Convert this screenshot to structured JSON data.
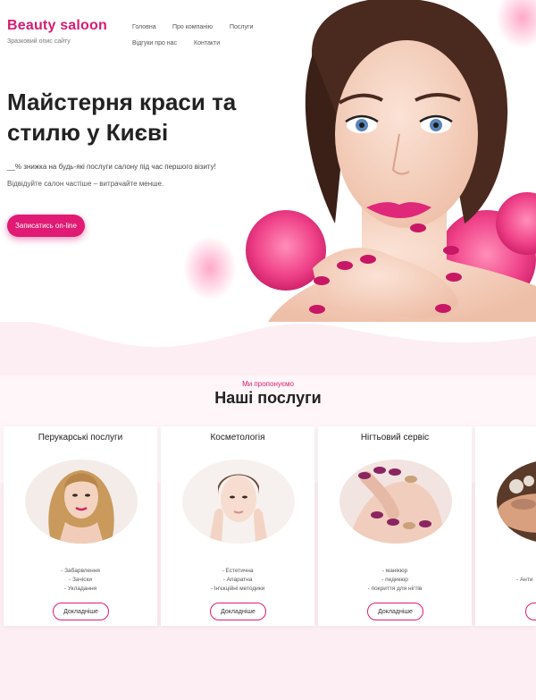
{
  "brand": {
    "title": "Beauty saloon",
    "subtitle": "Зразковий опис сайту"
  },
  "nav": {
    "items": [
      "Головна",
      "Про компанію",
      "Послуги",
      "Відгуки про нас",
      "Контакти"
    ]
  },
  "hero": {
    "headline_line1": "Майстерня краси та",
    "headline_line2": "стилю у Києві",
    "promo": "__% знижка на будь-які послуги салону під час першого візиту!",
    "tagline": "Відвідуйте салон частіше – витрачайте менше.",
    "cta_label": "Записатись on-line"
  },
  "services": {
    "eyebrow": "Ми пропонуємо",
    "title": "Наші послуги",
    "cards": [
      {
        "title": "Перукарські послуги",
        "items": [
          "- Забарвлення",
          "- Зачіски",
          "- Укладання"
        ],
        "button": "Докладніше",
        "image_icon": "hair-photo"
      },
      {
        "title": "Косметологія",
        "items": [
          "- Естетична",
          "- Апаратна",
          "- Ін'єкційні методики"
        ],
        "button": "Докладніше",
        "image_icon": "skin-photo"
      },
      {
        "title": "Нігтьовий сервіс",
        "items": [
          "- манікюр",
          "- педикюр",
          "- покриття для нігтів"
        ],
        "button": "Докладніше",
        "image_icon": "nails-photo"
      },
      {
        "title": "",
        "items": [
          "- Анти"
        ],
        "button": "",
        "image_icon": "massage-photo"
      }
    ]
  },
  "colors": {
    "accent": "#e11a74",
    "brand": "#d81b72",
    "wave": "#fdeef4"
  }
}
